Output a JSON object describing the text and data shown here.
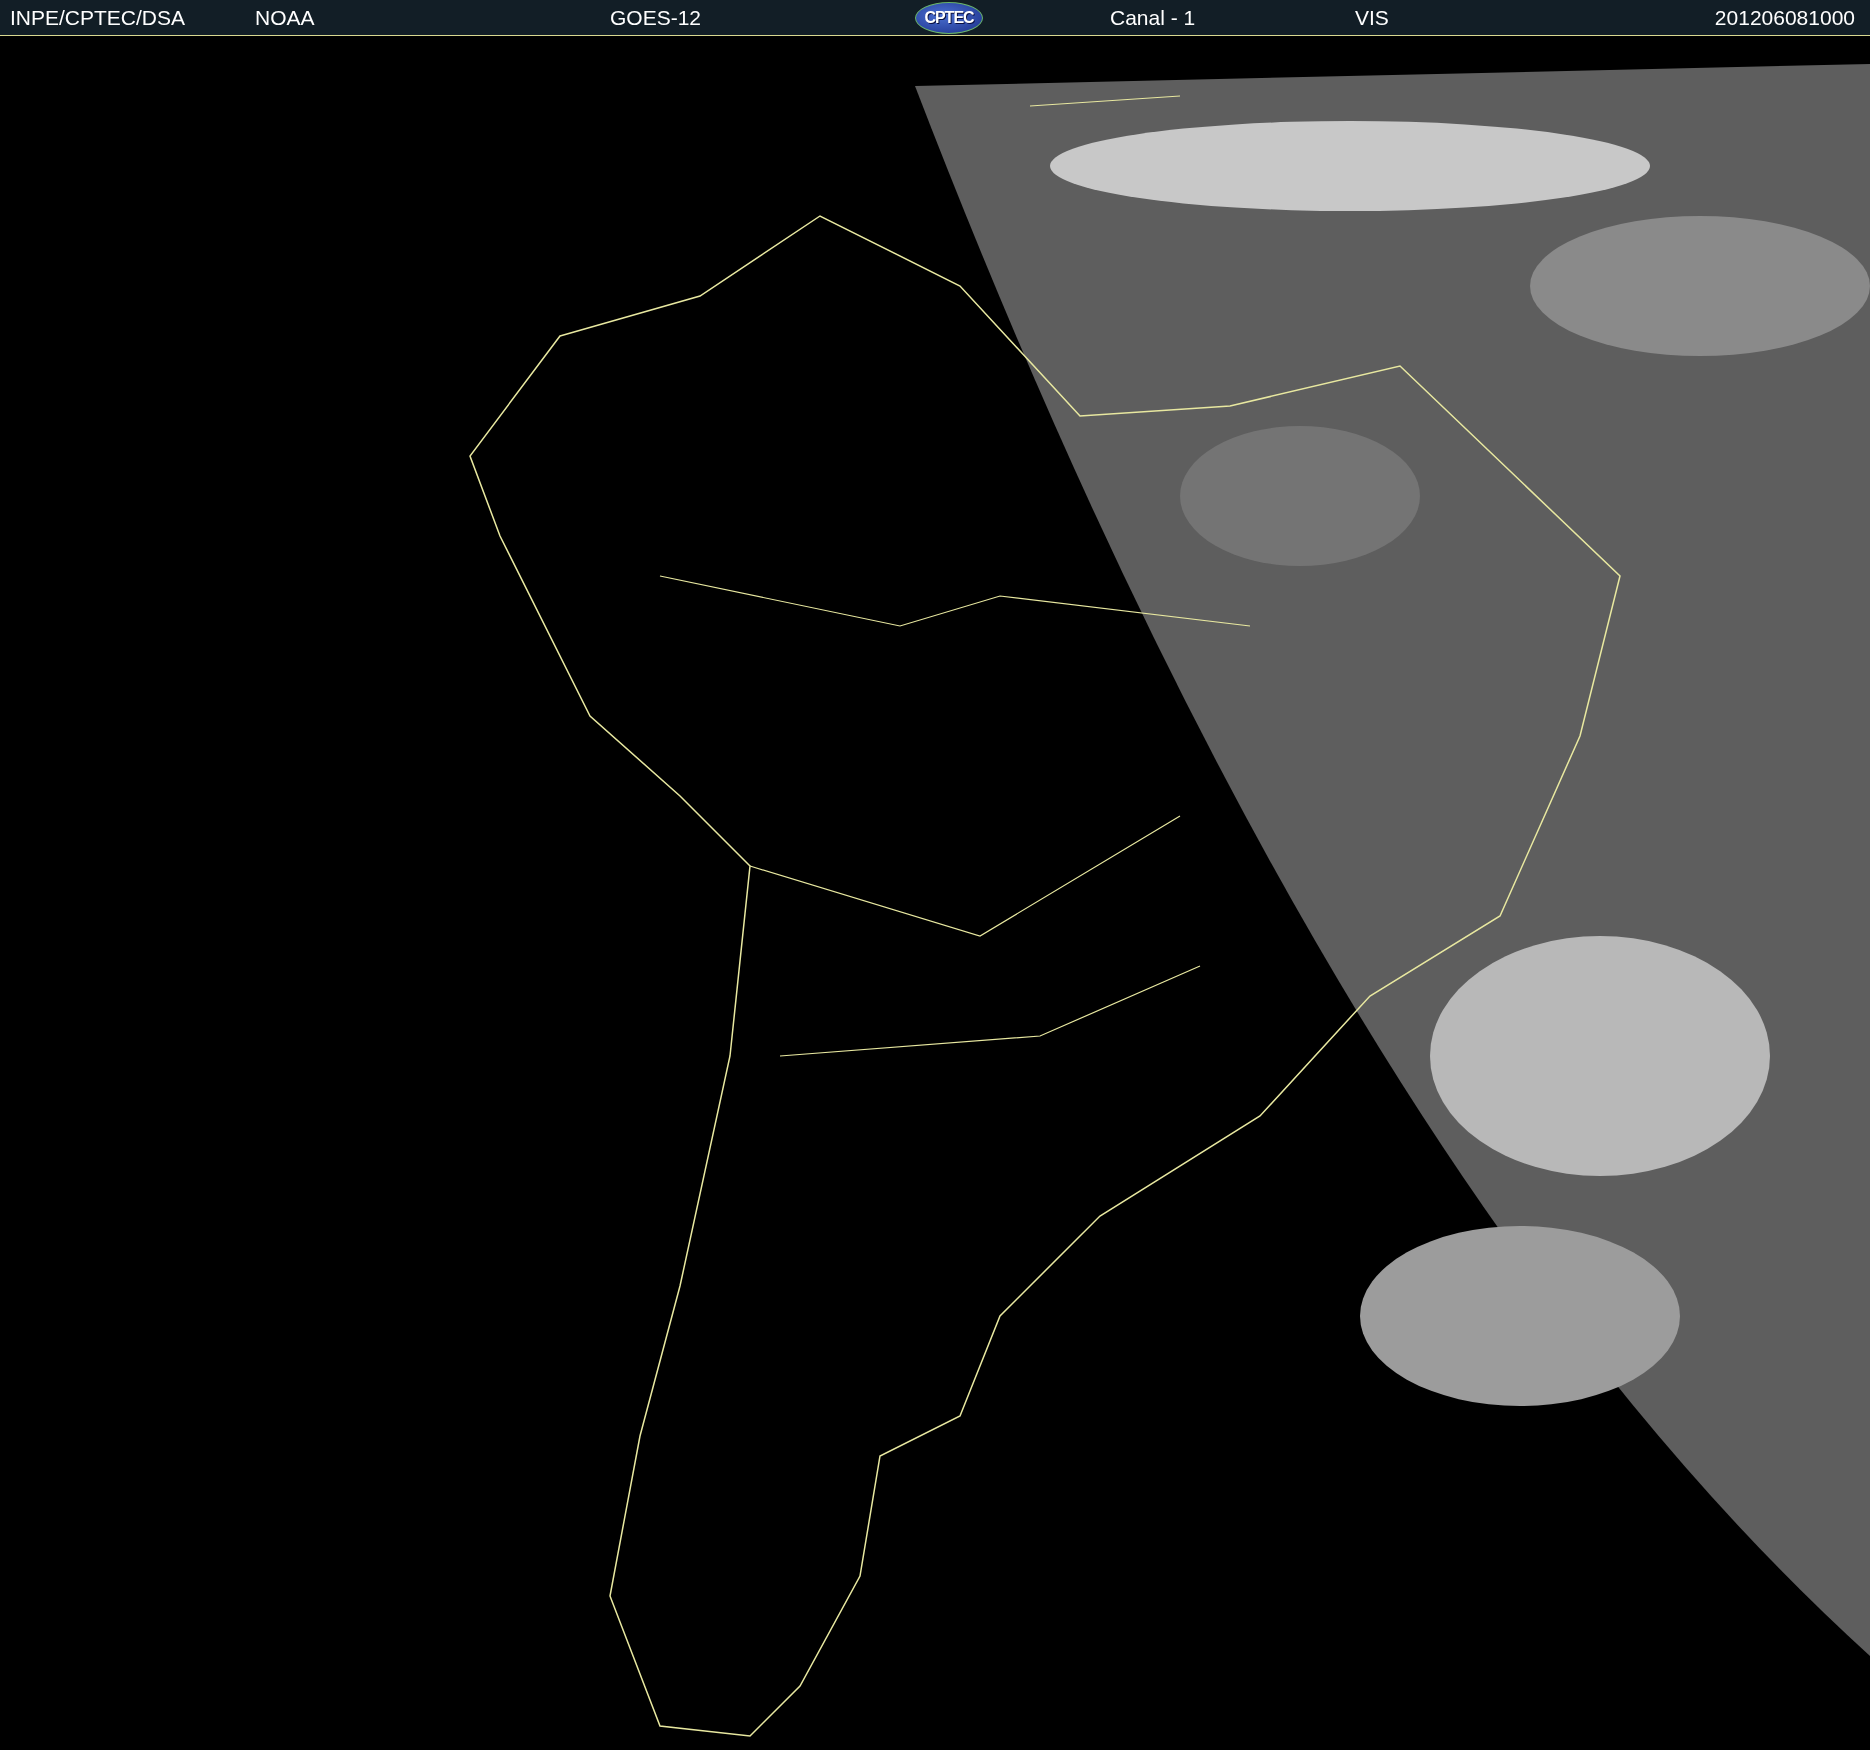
{
  "header": {
    "items": [
      {
        "kind": "text",
        "text": "INPE/CPTEC/DSA"
      },
      {
        "kind": "text",
        "text": "NOAA"
      },
      {
        "kind": "text",
        "text": "GOES-12"
      },
      {
        "kind": "logo",
        "text": "CPTEC"
      },
      {
        "kind": "text",
        "text": "Canal - 1"
      },
      {
        "kind": "text",
        "text": "VIS"
      },
      {
        "kind": "text",
        "text": "201206081000"
      }
    ]
  }
}
